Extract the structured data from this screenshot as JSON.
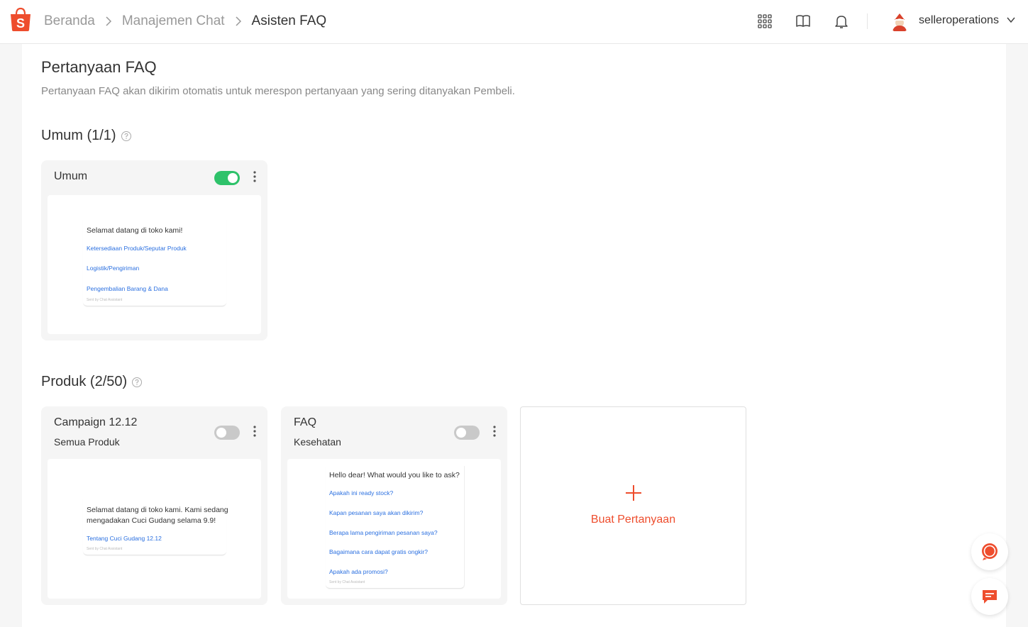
{
  "header": {
    "breadcrumb": [
      "Beranda",
      "Manajemen Chat",
      "Asisten FAQ"
    ],
    "username": "selleroperations"
  },
  "page": {
    "title": "Pertanyaan FAQ",
    "description": "Pertanyaan FAQ akan dikirim otomatis untuk merespon pertanyaan yang sering ditanyakan Pembeli."
  },
  "sections": {
    "general": {
      "title": "Umum (1/1)"
    },
    "product": {
      "title": "Produk (2/50)"
    }
  },
  "cards": [
    {
      "title": "Umum",
      "subtitle": "",
      "enabled": true,
      "greeting": "Selamat datang di toko kami!",
      "links": [
        "Ketersediaan Produk/Seputar Produk",
        "Logistik/Pengiriman",
        "Pengembalian Barang & Dana"
      ],
      "footer": "Sent by Chat Assistant"
    },
    {
      "title": "Campaign 12.12",
      "subtitle": "Semua Produk",
      "enabled": false,
      "greeting": "Selamat datang di toko kami. Kami sedang mengadakan Cuci Gudang selama 9.9!",
      "links": [
        "Tentang Cuci Gudang 12.12"
      ],
      "footer": "Sent by Chat Assistant"
    },
    {
      "title": "FAQ",
      "subtitle": "Kesehatan",
      "enabled": false,
      "greeting": "Hello dear! What would you like to ask?",
      "links": [
        "Apakah ini ready stock?",
        "Kapan pesanan saya akan dikirim?",
        "Berapa lama pengiriman pesanan saya?",
        "Bagaimana cara dapat gratis ongkir?",
        "Apakah ada promosi?"
      ],
      "footer": "Sent by Chat Assistant"
    }
  ],
  "add_card": {
    "label": "Buat Pertanyaan"
  },
  "colors": {
    "brand": "#ee4d2d",
    "toggle_on": "#2ec26a",
    "link": "#2a6fe0"
  },
  "icons": [
    "shopee-logo-icon",
    "chevron-right-icon",
    "apps-grid-icon",
    "book-icon",
    "bell-icon",
    "chevron-down-icon",
    "help-icon",
    "kebab-icon",
    "plus-icon",
    "chat-bubble-icon",
    "chat-message-icon"
  ]
}
